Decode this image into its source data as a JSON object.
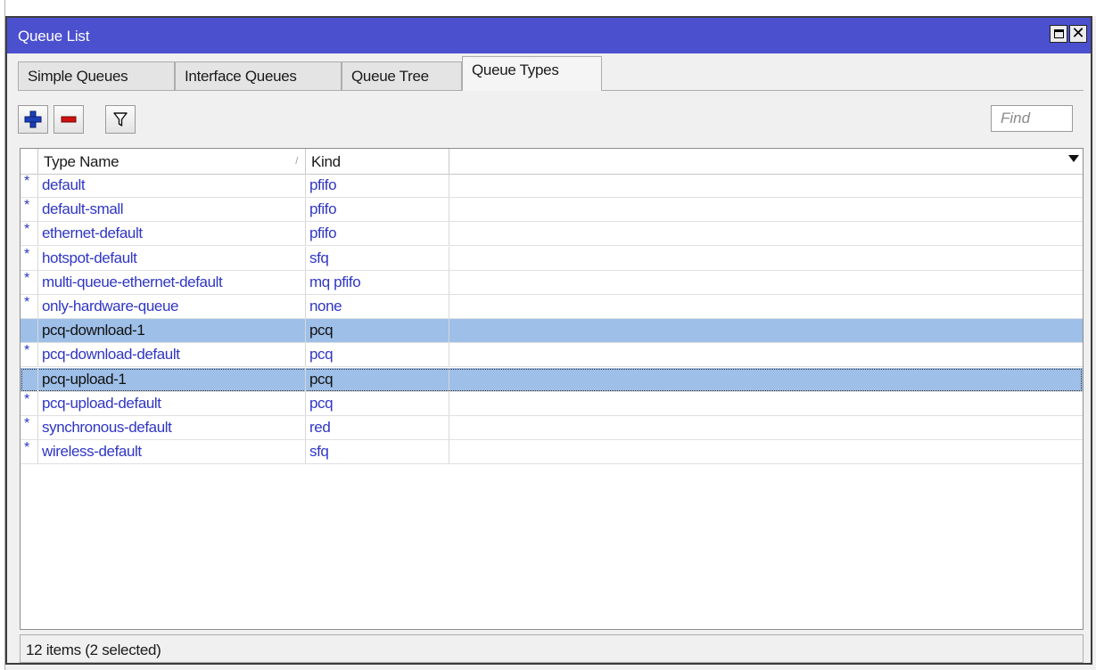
{
  "window": {
    "title": "Queue List"
  },
  "tabs": [
    {
      "label": "Simple Queues",
      "active": false
    },
    {
      "label": "Interface Queues",
      "active": false
    },
    {
      "label": "Queue Tree",
      "active": false
    },
    {
      "label": "Queue Types",
      "active": true
    }
  ],
  "toolbar": {
    "add_icon": "plus-icon",
    "remove_icon": "minus-icon",
    "filter_icon": "filter-icon",
    "find_placeholder": "Find"
  },
  "table": {
    "columns": [
      "Type Name",
      "Kind"
    ],
    "sorted_column": "Type Name",
    "sort_indicator": "/",
    "rows": [
      {
        "flag": "*",
        "name": "default",
        "kind": "pfifo",
        "selected": false
      },
      {
        "flag": "*",
        "name": "default-small",
        "kind": "pfifo",
        "selected": false
      },
      {
        "flag": "*",
        "name": "ethernet-default",
        "kind": "pfifo",
        "selected": false
      },
      {
        "flag": "*",
        "name": "hotspot-default",
        "kind": "sfq",
        "selected": false
      },
      {
        "flag": "*",
        "name": "multi-queue-ethernet-default",
        "kind": "mq pfifo",
        "selected": false
      },
      {
        "flag": "*",
        "name": "only-hardware-queue",
        "kind": "none",
        "selected": false
      },
      {
        "flag": "",
        "name": "pcq-download-1",
        "kind": "pcq",
        "selected": true
      },
      {
        "flag": "*",
        "name": "pcq-download-default",
        "kind": "pcq",
        "selected": false
      },
      {
        "flag": "",
        "name": "pcq-upload-1",
        "kind": "pcq",
        "selected": true
      },
      {
        "flag": "*",
        "name": "pcq-upload-default",
        "kind": "pcq",
        "selected": false
      },
      {
        "flag": "*",
        "name": "synchronous-default",
        "kind": "red",
        "selected": false
      },
      {
        "flag": "*",
        "name": "wireless-default",
        "kind": "sfq",
        "selected": false
      }
    ]
  },
  "status": {
    "text": "12 items (2 selected)"
  },
  "colors": {
    "titlebar": "#4b50cf",
    "selection": "#9ebfe8",
    "dynamic_text": "#2f36c4",
    "add_icon": "#1c3fb8",
    "remove_icon": "#d01010"
  }
}
